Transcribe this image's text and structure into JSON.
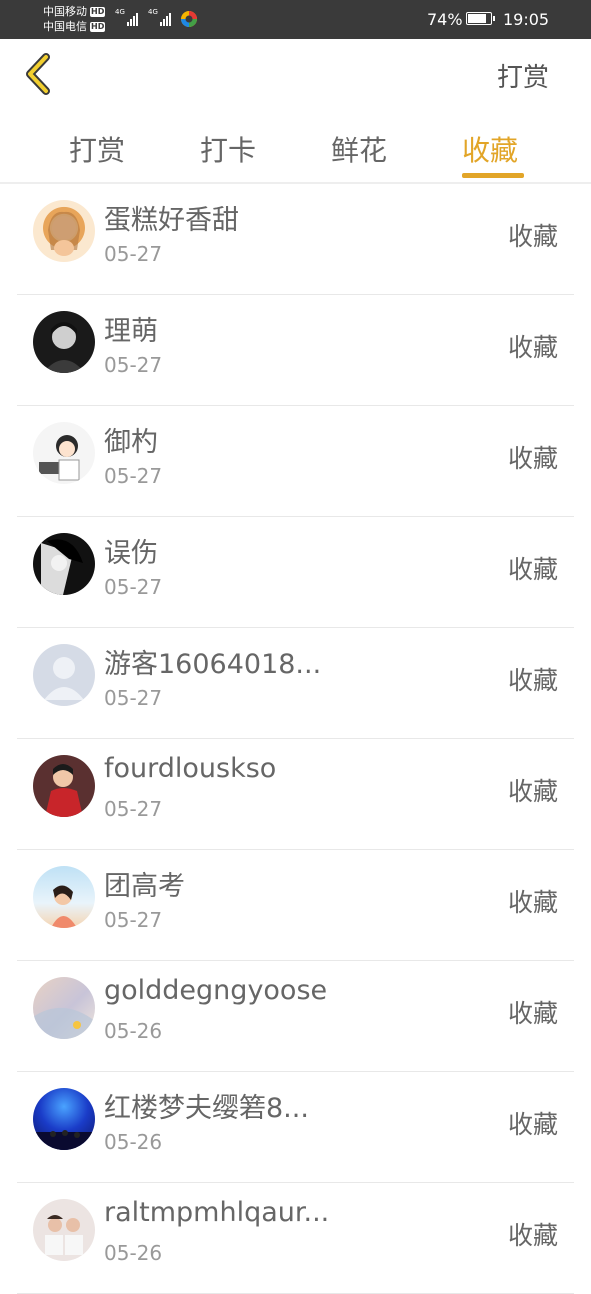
{
  "status_bar": {
    "carrier_1": "中国移动",
    "carrier_2": "中国电信",
    "hd_badge": "HD",
    "network_1": "4G",
    "network_2": "4G",
    "battery": "74%",
    "time": "19:05"
  },
  "header": {
    "back_icon": "chevron-left-icon",
    "title": "打赏"
  },
  "tabs": [
    {
      "label": "打赏"
    },
    {
      "label": "打卡"
    },
    {
      "label": "鲜花"
    },
    {
      "label": "收藏"
    }
  ],
  "active_tab": "收藏",
  "accent_color": "#e2a528",
  "list": [
    {
      "name": "蛋糕好香甜",
      "date": "05-27",
      "action": "收藏"
    },
    {
      "name": "理萌",
      "date": "05-27",
      "action": "收藏"
    },
    {
      "name": "御杓",
      "date": "05-27",
      "action": "收藏"
    },
    {
      "name": "误伤",
      "date": "05-27",
      "action": "收藏"
    },
    {
      "name": "游客16064018...",
      "date": "05-27",
      "action": "收藏"
    },
    {
      "name": "fourdlouskso",
      "date": "05-27",
      "action": "收藏"
    },
    {
      "name": "团高考",
      "date": "05-27",
      "action": "收藏"
    },
    {
      "name": "golddegngyoose",
      "date": "05-26",
      "action": "收藏"
    },
    {
      "name": "红楼梦夫缨箬8...",
      "date": "05-26",
      "action": "收藏"
    },
    {
      "name": "raltmpmhlqaur...",
      "date": "05-26",
      "action": "收藏"
    }
  ]
}
